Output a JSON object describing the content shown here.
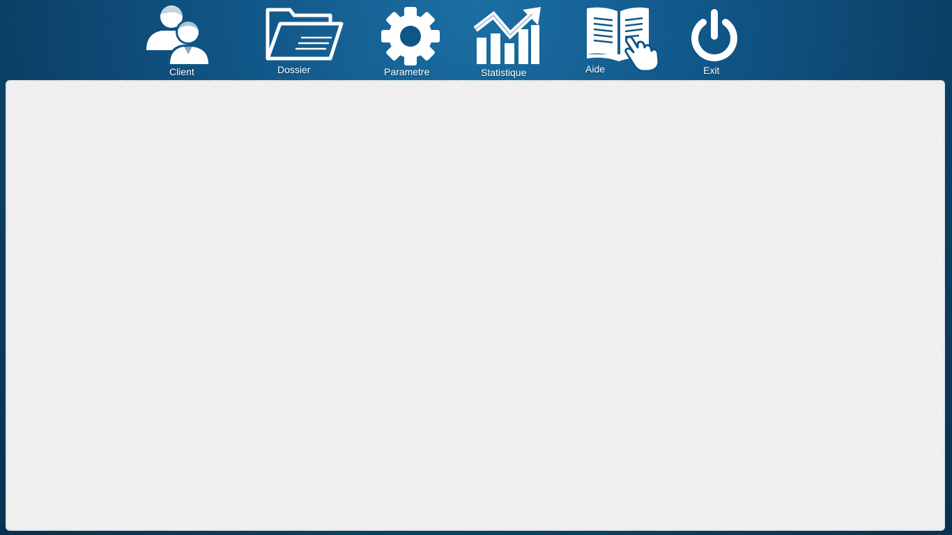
{
  "nav": {
    "client": {
      "label": "Client",
      "icon": "users-icon"
    },
    "dossier": {
      "label": "Dossier",
      "icon": "folder-open-icon"
    },
    "parametre": {
      "label": "Parametre",
      "icon": "gear-icon"
    },
    "statistique": {
      "label": "Statistique",
      "icon": "chart-up-icon"
    },
    "aide": {
      "label": "Aide",
      "icon": "book-hand-icon"
    },
    "exit": {
      "label": "Exit",
      "icon": "power-icon"
    }
  },
  "colors": {
    "background_accent": "#0f5688",
    "icon_color": "#ffffff",
    "content_panel": "#f2f2f2"
  }
}
